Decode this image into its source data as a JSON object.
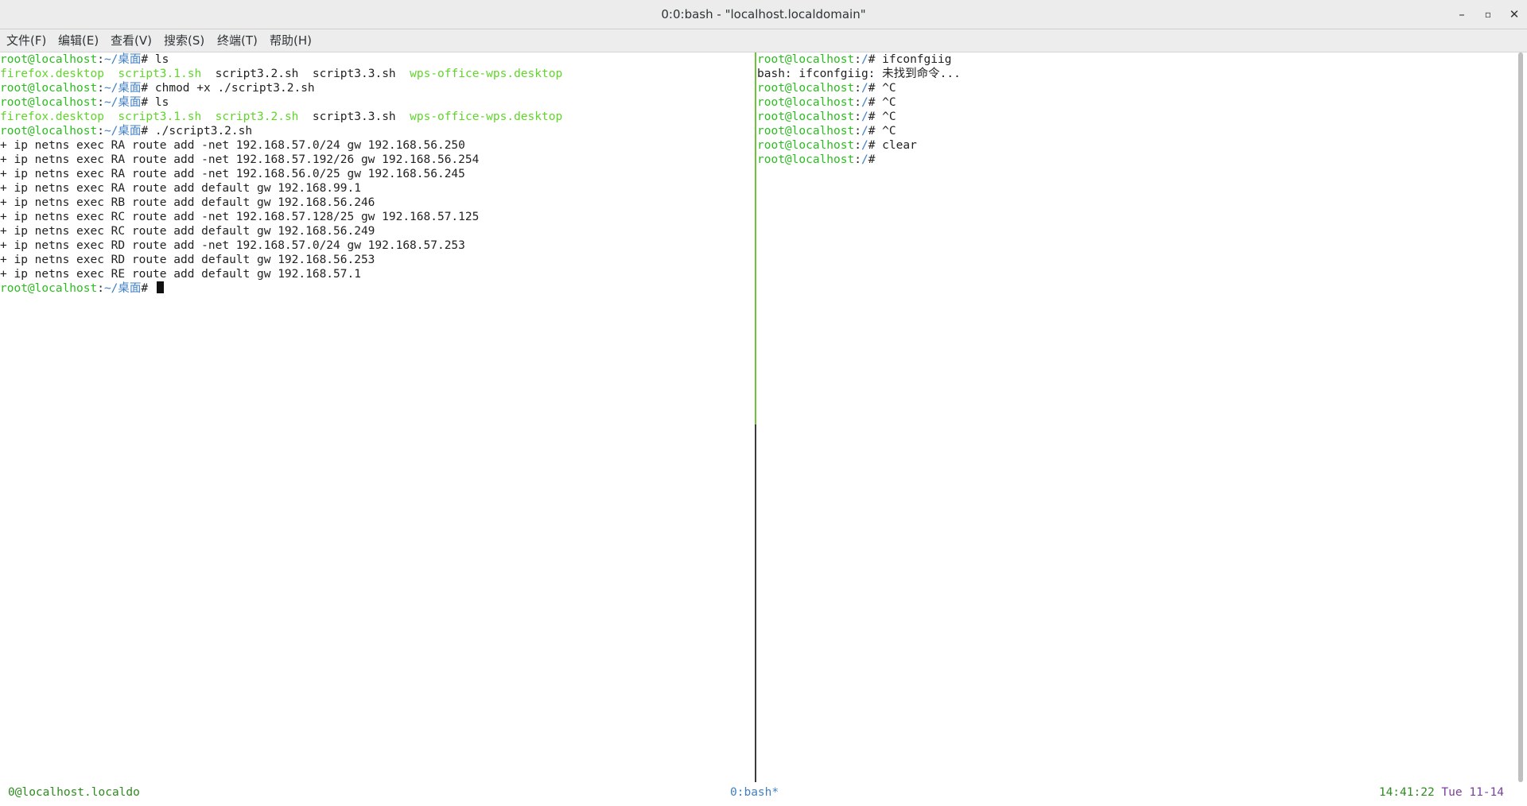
{
  "window": {
    "title": "0:0:bash - \"localhost.localdomain\"",
    "minimize": "–",
    "maximize": "▫",
    "close": "✕"
  },
  "menu": [
    "文件(F)",
    "编辑(E)",
    "查看(V)",
    "搜索(S)",
    "终端(T)",
    "帮助(H)"
  ],
  "left_pane": {
    "l1_user": "root@localhost",
    "l1_path": "~/桌面",
    "l1_cmd": "# ls",
    "l2_f1": "firefox.desktop",
    "l2_f2": "script3.1.sh",
    "l2_f3": "script3.2.sh",
    "l2_f4": "script3.3.sh",
    "l2_f5": "wps-office-wps.desktop",
    "l3_user": "root@localhost",
    "l3_path": "~/桌面",
    "l3_cmd": "# chmod +x ./script3.2.sh",
    "l4_user": "root@localhost",
    "l4_path": "~/桌面",
    "l4_cmd": "# ls",
    "l5_f1": "firefox.desktop",
    "l5_f2": "script3.1.sh",
    "l5_f3": "script3.2.sh",
    "l5_f4": "script3.3.sh",
    "l5_f5": "wps-office-wps.desktop",
    "l6_user": "root@localhost",
    "l6_path": "~/桌面",
    "l6_cmd": "# ./script3.2.sh",
    "trace": [
      "+ ip netns exec RA route add -net 192.168.57.0/24 gw 192.168.56.250",
      "+ ip netns exec RA route add -net 192.168.57.192/26 gw 192.168.56.254",
      "+ ip netns exec RA route add -net 192.168.56.0/25 gw 192.168.56.245",
      "+ ip netns exec RA route add default gw 192.168.99.1",
      "+ ip netns exec RB route add default gw 192.168.56.246",
      "+ ip netns exec RC route add -net 192.168.57.128/25 gw 192.168.57.125",
      "+ ip netns exec RC route add default gw 192.168.56.249",
      "+ ip netns exec RD route add -net 192.168.57.0/24 gw 192.168.57.253",
      "+ ip netns exec RD route add default gw 192.168.56.253",
      "+ ip netns exec RE route add default gw 192.168.57.1"
    ],
    "last_user": "root@localhost",
    "last_path": "~/桌面",
    "last_cmd": "# "
  },
  "right_pane": {
    "r1_user": "root@localhost",
    "r1_path": "/",
    "r1_cmd": "# ifconfgiig",
    "r2_text": "bash: ifconfgiig: 未找到命令...",
    "r3_user": "root@localhost",
    "r3_path": "/",
    "r3_cmd": "# ^C",
    "r4_user": "root@localhost",
    "r4_path": "/",
    "r4_cmd": "# ^C",
    "r5_user": "root@localhost",
    "r5_path": "/",
    "r5_cmd": "# ^C",
    "r6_user": "root@localhost",
    "r6_path": "/",
    "r6_cmd": "# ^C",
    "r7_user": "root@localhost",
    "r7_path": "/",
    "r7_cmd": "# clear",
    "r8_user": "root@localhost",
    "r8_path": "/",
    "r8_cmd": "#"
  },
  "status": {
    "session": "0@localhost.localdo",
    "window_prefix": "0:",
    "window_name": "bash*",
    "time": "14:41:22",
    "date": "Tue 11-14"
  },
  "colors": {
    "prompt": "#2bbd1f",
    "path": "#3f7fc4",
    "executable": "#5fd629",
    "active_pane_border": "#6fc33a"
  }
}
